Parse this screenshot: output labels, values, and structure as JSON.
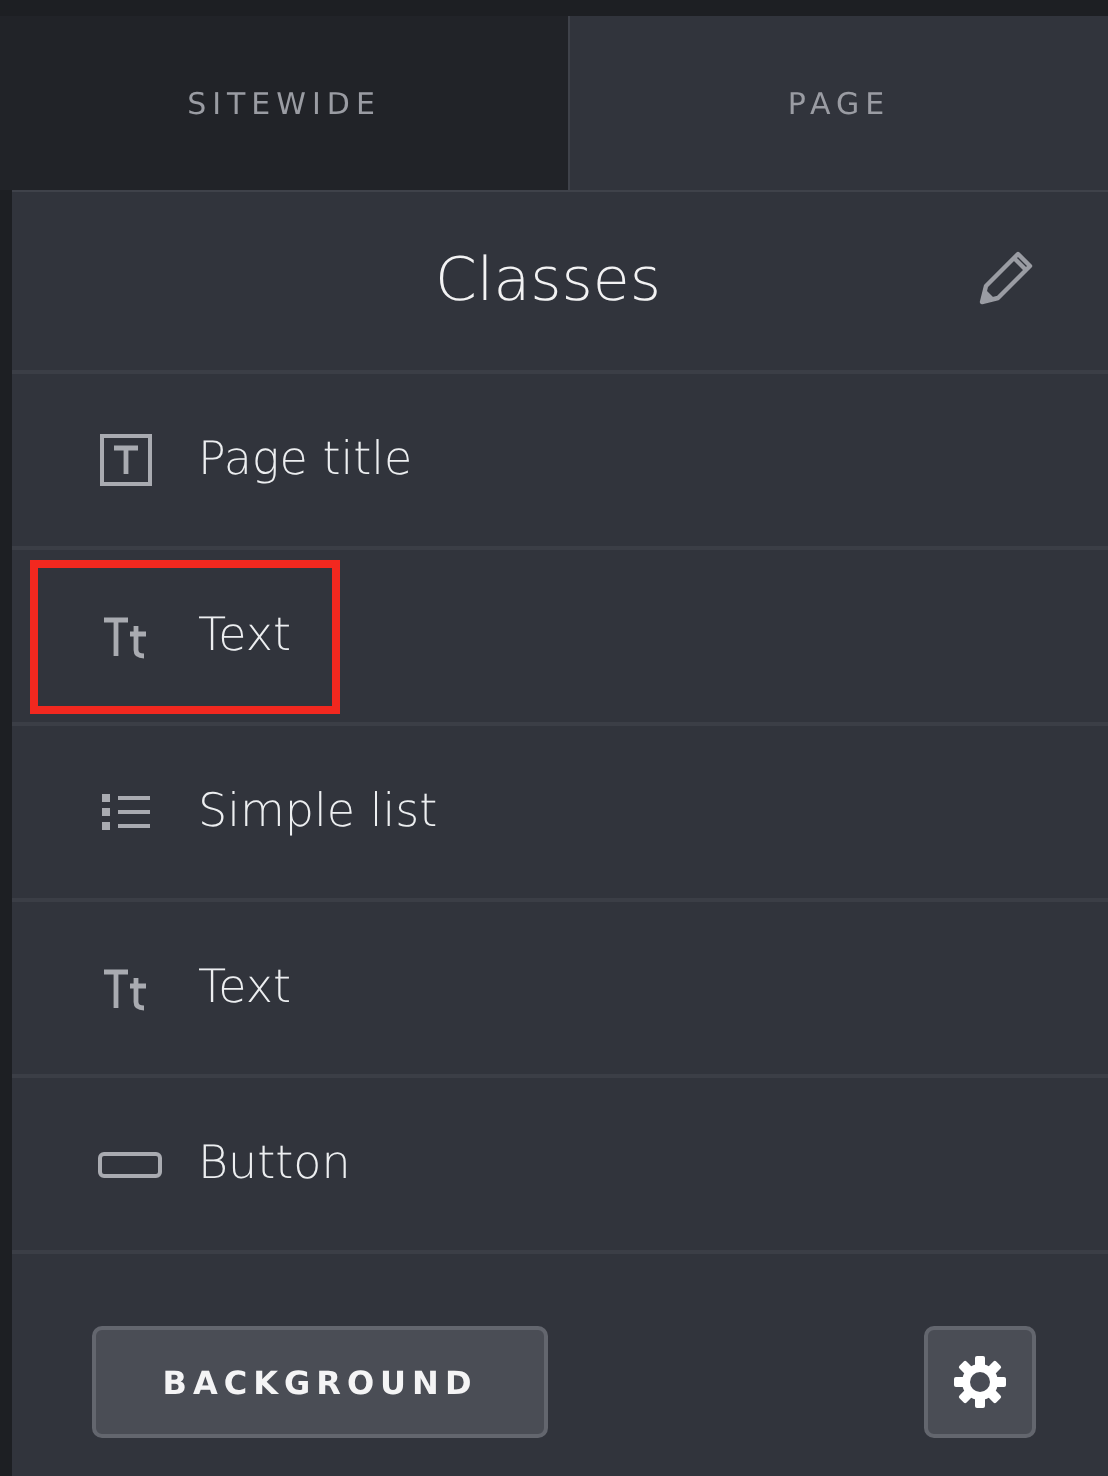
{
  "tabs": [
    {
      "label": "SITEWIDE",
      "selected": false
    },
    {
      "label": "PAGE",
      "selected": true
    }
  ],
  "panel": {
    "title": "Classes"
  },
  "items": [
    {
      "kind": "title",
      "label": "Page title",
      "highlighted": false
    },
    {
      "kind": "text",
      "label": "Text",
      "highlighted": true
    },
    {
      "kind": "list",
      "label": "Simple list",
      "highlighted": false
    },
    {
      "kind": "text",
      "label": "Text",
      "highlighted": false
    },
    {
      "kind": "button",
      "label": "Button",
      "highlighted": false
    }
  ],
  "footer": {
    "button": "BACKGROUND"
  }
}
